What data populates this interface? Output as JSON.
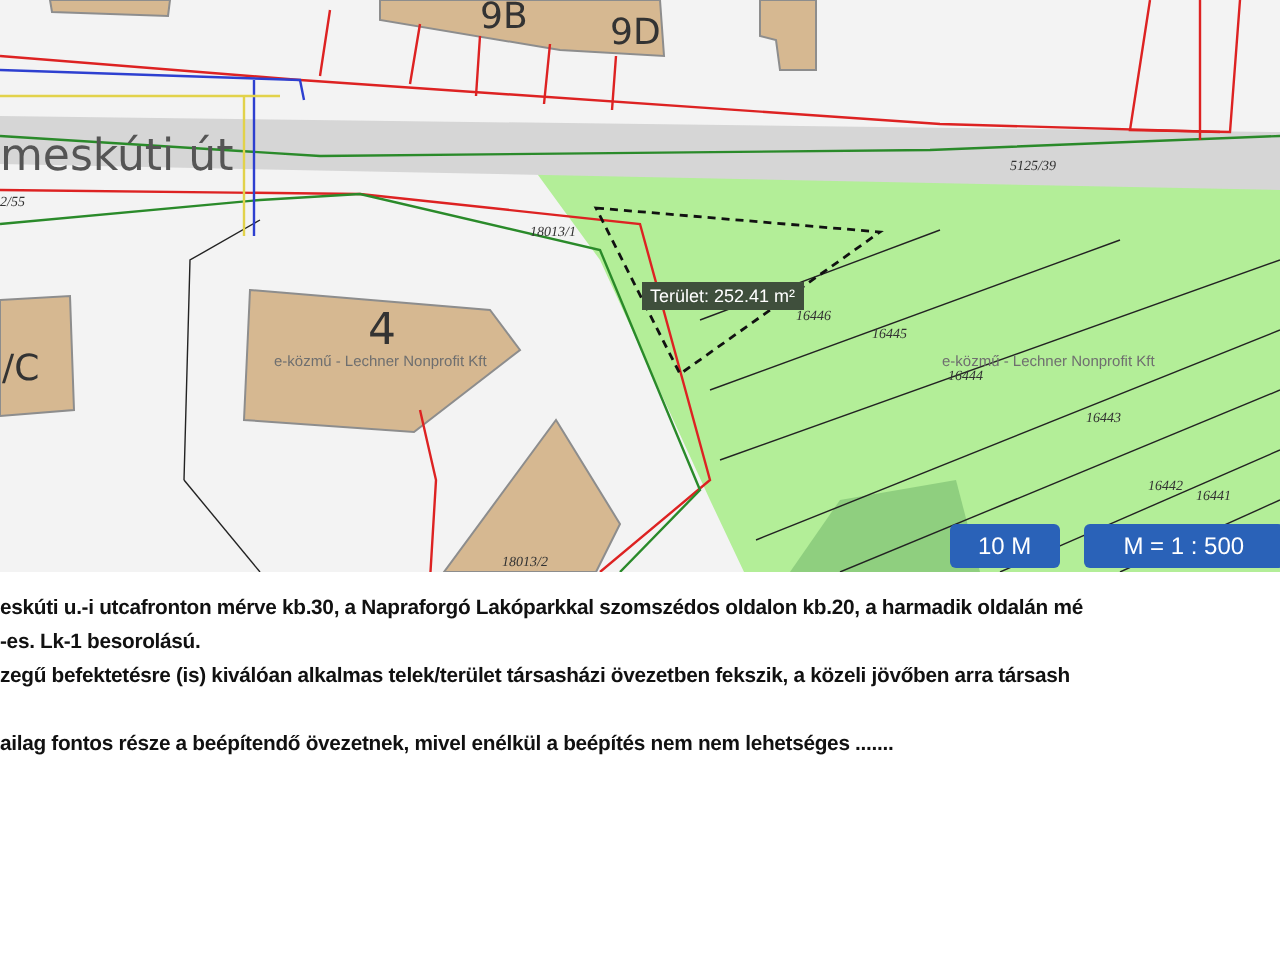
{
  "map": {
    "street_name": "meskúti út",
    "house_numbers": [
      "9B",
      "9D",
      "4",
      "/C"
    ],
    "parcel_numbers": [
      "5125/39",
      "18013/1",
      "2/55",
      "16446",
      "16445",
      "16444",
      "16443",
      "16442",
      "16441",
      "18013/2"
    ],
    "attributions": [
      "e-közmű - Lechner Nonprofit Kft",
      "e-közmű - Lechner Nonprofit Kft"
    ],
    "area_label": "Terület: 252.41 m²",
    "scale_buttons": [
      "10 M",
      "M = 1 : 500"
    ]
  },
  "description": [
    "eskúti u.-i utcafronton mérve kb.30, a Napraforgó Lakóparkkal szomszédos oldalon kb.20, a harmadik oldalán mé",
    "-es. Lk-1 besorolású.",
    "zegű befektetésre (is) kiválóan alkalmas telek/terület társasházi övezetben fekszik, a közeli jövőben arra társash",
    "ailag fontos része a beépítendő övezetnek, mivel enélkül a beépítés nem nem lehetséges ......."
  ]
}
